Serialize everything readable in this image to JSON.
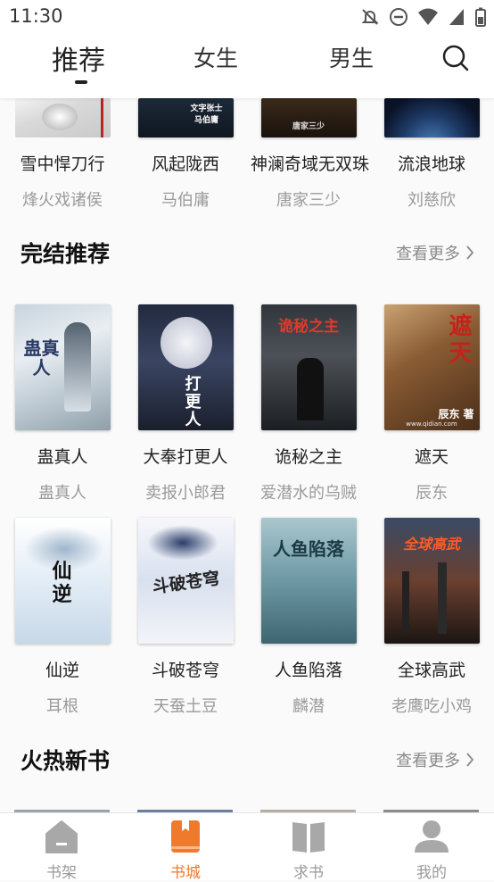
{
  "status_bar": {
    "time": "11:30"
  },
  "tabs": [
    {
      "label": "推荐",
      "active": true
    },
    {
      "label": "女生",
      "active": false
    },
    {
      "label": "男生",
      "active": false
    }
  ],
  "top_row": [
    {
      "title": "雪中悍刀行",
      "author": "烽火戏诸侯"
    },
    {
      "title": "风起陇西",
      "author": "马伯庸"
    },
    {
      "title": "神澜奇域无双珠",
      "author": "唐家三少"
    },
    {
      "title": "流浪地球",
      "author": "刘慈欣"
    }
  ],
  "completed": {
    "title": "完结推荐",
    "more": "查看更多",
    "books": [
      {
        "title": "蛊真人",
        "author": "蛊真人"
      },
      {
        "title": "大奉打更人",
        "author": "卖报小郎君"
      },
      {
        "title": "诡秘之主",
        "author": "爱潜水的乌贼"
      },
      {
        "title": "遮天",
        "author": "辰东"
      },
      {
        "title": "仙逆",
        "author": "耳根"
      },
      {
        "title": "斗破苍穹",
        "author": "天蚕土豆"
      },
      {
        "title": "人鱼陷落",
        "author": "麟潜"
      },
      {
        "title": "全球高武",
        "author": "老鹰吃小鸡"
      }
    ]
  },
  "hot_new": {
    "title": "火热新书",
    "more": "查看更多"
  },
  "covers": {
    "b1": "文字张士 马伯庸",
    "b3": "唐家三少",
    "c0": "蛊真人",
    "c1": "打更人",
    "c2": "诡秘之主",
    "c3": "遮天",
    "c3_author": "辰东 著",
    "c3_site": "www.qidian.com",
    "c4": "仙逆",
    "c5": "斗破苍穹",
    "c6": "人鱼陷落",
    "c7": "全球高武"
  },
  "bottom_nav": [
    {
      "label": "书架",
      "icon": "bookshelf-icon",
      "active": false
    },
    {
      "label": "书城",
      "icon": "bookstore-icon",
      "active": true
    },
    {
      "label": "求书",
      "icon": "request-book-icon",
      "active": false
    },
    {
      "label": "我的",
      "icon": "profile-icon",
      "active": false
    }
  ],
  "colors": {
    "accent": "#f07a2c",
    "inactive": "#9a9a9a"
  }
}
